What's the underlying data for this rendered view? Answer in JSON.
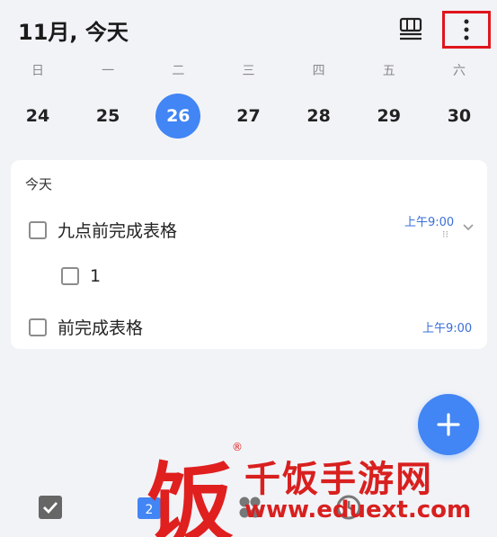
{
  "header": {
    "title": "11月, 今天",
    "view_toggle_icon": "view-toggle-icon",
    "more_icon": "more-vertical-icon"
  },
  "week": {
    "weekdays": [
      "日",
      "一",
      "二",
      "三",
      "四",
      "五",
      "六"
    ],
    "dates": [
      "24",
      "25",
      "26",
      "27",
      "28",
      "29",
      "30"
    ],
    "selected_date": "26"
  },
  "card": {
    "section_label": "今天",
    "tasks": [
      {
        "title": "九点前完成表格",
        "time": "上午9:00",
        "subtask_hint": "⁝⁝",
        "subtasks": [
          {
            "title": "1"
          }
        ]
      },
      {
        "title": "前完成表格",
        "time": "上午9:00"
      }
    ]
  },
  "fab": {
    "icon": "plus-icon"
  },
  "bottom_nav": {
    "items": [
      "checkbox-icon",
      "calendar-icon",
      "apps-icon",
      "clock-icon"
    ]
  },
  "watermark": {
    "logo": "饭",
    "reg": "®",
    "name": "千饭手游网",
    "url": "www.eduext.com"
  },
  "colors": {
    "accent": "#4285f4",
    "highlight_border": "#e0151c",
    "watermark": "#d8201f"
  }
}
